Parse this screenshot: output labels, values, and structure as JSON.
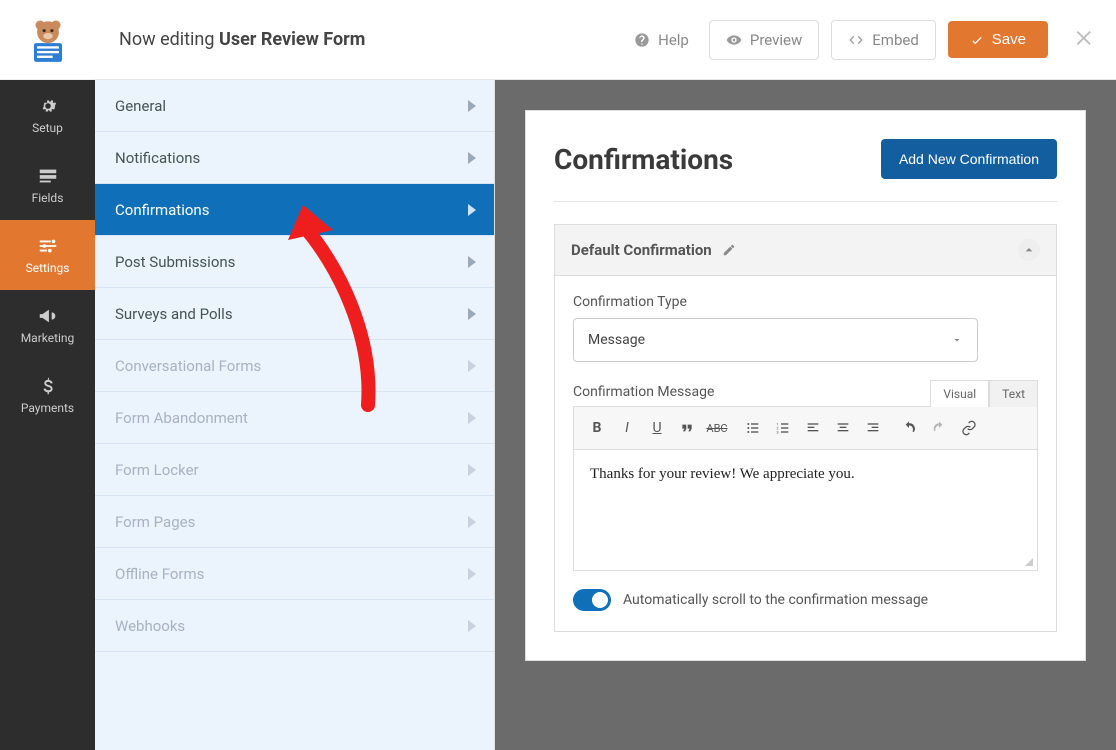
{
  "header": {
    "editing_prefix": "Now editing ",
    "form_name": "User Review Form",
    "help": "Help",
    "preview": "Preview",
    "embed": "Embed",
    "save": "Save"
  },
  "rail": {
    "setup": "Setup",
    "fields": "Fields",
    "settings": "Settings",
    "marketing": "Marketing",
    "payments": "Payments"
  },
  "submenu": {
    "general": "General",
    "notifications": "Notifications",
    "confirmations": "Confirmations",
    "post_submissions": "Post Submissions",
    "surveys": "Surveys and Polls",
    "conversational": "Conversational Forms",
    "abandonment": "Form Abandonment",
    "locker": "Form Locker",
    "pages": "Form Pages",
    "offline": "Offline Forms",
    "webhooks": "Webhooks"
  },
  "panel": {
    "title": "Confirmations",
    "add_button": "Add New Confirmation",
    "accordion_title": "Default Confirmation",
    "type_label": "Confirmation Type",
    "type_value": "Message",
    "message_label": "Confirmation Message",
    "tab_visual": "Visual",
    "tab_text": "Text",
    "message_value": "Thanks for your review! We appreciate you.",
    "toggle_label": "Automatically scroll to the confirmation message"
  },
  "colors": {
    "accent": "#e27730",
    "submenu_active": "#0f6fb9",
    "add_button": "#135e9e"
  }
}
